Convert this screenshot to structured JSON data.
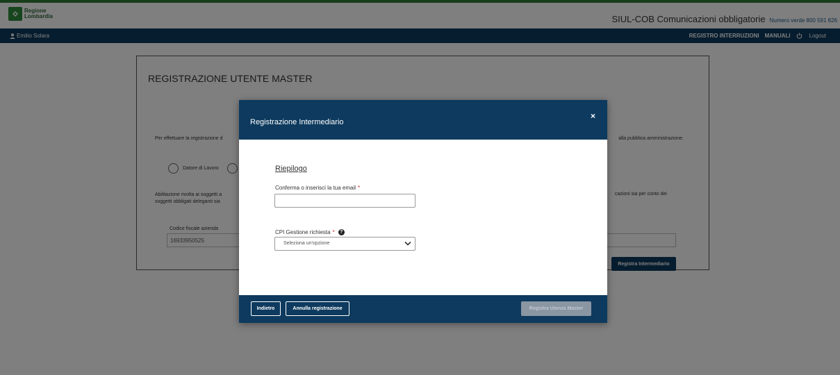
{
  "header": {
    "logo_text": "Regione Lombardia",
    "brand": "SIUL-COB Comunicazioni obbligatorie",
    "numero_verde": "Numero verde 800 591 826"
  },
  "navbar": {
    "user_name": "Emilio Solara",
    "items": [
      "REGISTRO INTERRUZIONI",
      "MANUALI"
    ],
    "logout": "Logout"
  },
  "card": {
    "title": "REGISTRAZIONE UTENTE MASTER",
    "intro_left": "Per effettuare la registrazione d",
    "intro_right": "alla pubblica amministrazione.",
    "radio_option_1": "Datore di Lavoro",
    "abilitazione_left_1": "Abilitazione rivolta ai soggetti a",
    "abilitazione_left_2": "soggetti obbligati deleganti sia",
    "abilitazione_right": "cazioni sia per conto dei",
    "codice_fiscale_label": "Codice fiscale azienda",
    "codice_fiscale_value": "16933950525",
    "register_button": "Registra Intermediario"
  },
  "modal": {
    "title": "Registrazione Intermediario",
    "close_symbol": "×",
    "section_title": "Riepilogo",
    "email_label": "Conferma o inserisci la tua email",
    "required_mark": "*",
    "email_value": "",
    "cpi_label": "CPI Gestione richiesta",
    "help_symbol": "?",
    "cpi_placeholder": "Seleziona un'opzione",
    "buttons": {
      "back": "Indietro",
      "cancel": "Annulla registrazione",
      "submit": "Registra Utenza Master"
    }
  },
  "colors": {
    "navy": "#0d3a5e",
    "green_line": "#2e7d32",
    "required": "#c62828"
  }
}
